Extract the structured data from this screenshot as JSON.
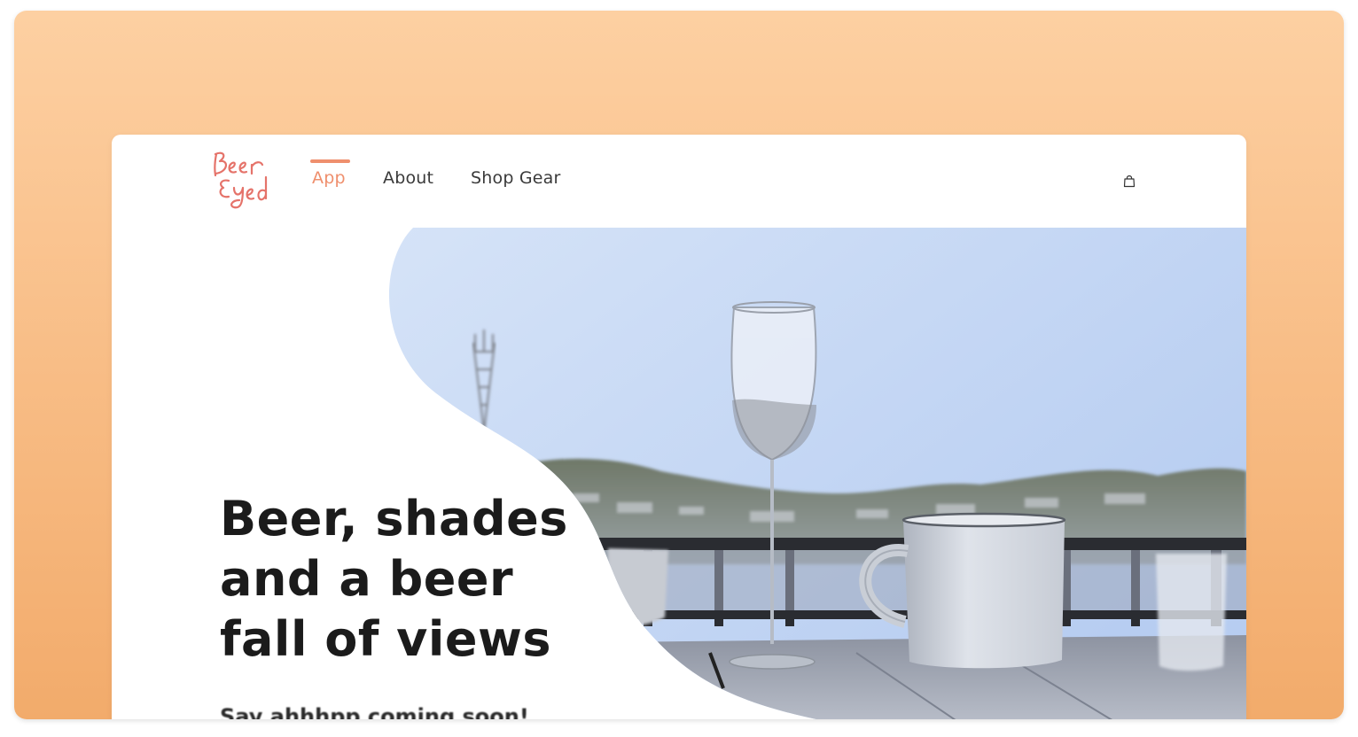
{
  "brand": {
    "logo_text": "Beer Eyed",
    "color": "#e5736a"
  },
  "nav": {
    "items": [
      {
        "label": "App",
        "active": true
      },
      {
        "label": "About",
        "active": false
      },
      {
        "label": "Shop Gear",
        "active": false
      }
    ],
    "accent_color": "#ef8f6d",
    "cart_icon": "shopping-bag-icon"
  },
  "hero": {
    "headline": "Beer, shades and a beer fall of views",
    "subline": "Say ahhhpp coming soon!",
    "image_subject": "outdoor table with champagne flute and mug overlooking hillside"
  },
  "colors": {
    "background_gradient_top": "#fdd0a2",
    "background_gradient_bottom": "#f2ab6b",
    "text_dark": "#1b1b1b"
  }
}
